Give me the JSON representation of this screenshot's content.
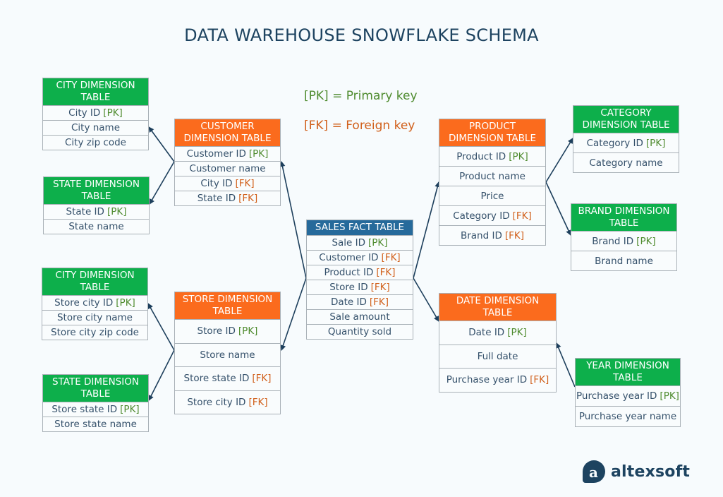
{
  "title": "DATA WAREHOUSE SNOWFLAKE SCHEMA",
  "legend": {
    "pk": "[PK] = Primary key",
    "fk": "[FK] = Foreign key"
  },
  "colors": {
    "dimension_header": "#0daf4b",
    "first_level_header": "#fb6b1d",
    "fact_header": "#266a9b",
    "pk_text": "#4e8b2e",
    "fk_text": "#d1601b",
    "connector": "#1d3f5c"
  },
  "tables": {
    "city_customer": {
      "title": "CITY DIMENSION TABLE",
      "rows": [
        {
          "text": "City ID",
          "key": "[PK]"
        },
        {
          "text": "City name",
          "key": ""
        },
        {
          "text": "City zip code",
          "key": ""
        }
      ]
    },
    "state_customer": {
      "title": "STATE DIMENSION TABLE",
      "rows": [
        {
          "text": "State ID",
          "key": "[PK]"
        },
        {
          "text": "State name",
          "key": ""
        }
      ]
    },
    "customer": {
      "title": "CUSTOMER DIMENSION TABLE",
      "rows": [
        {
          "text": "Customer ID",
          "key": "[PK]"
        },
        {
          "text": "Customer name",
          "key": ""
        },
        {
          "text": "City ID",
          "key": "[FK]"
        },
        {
          "text": "State ID",
          "key": "[FK]"
        }
      ]
    },
    "city_store": {
      "title": "CITY DIMENSION TABLE",
      "rows": [
        {
          "text": "Store city ID",
          "key": "[PK]"
        },
        {
          "text": "Store city name",
          "key": ""
        },
        {
          "text": "Store city zip code",
          "key": ""
        }
      ]
    },
    "state_store": {
      "title": "STATE DIMENSION TABLE",
      "rows": [
        {
          "text": "Store state ID",
          "key": "[PK]"
        },
        {
          "text": "Store state name",
          "key": ""
        }
      ]
    },
    "store": {
      "title": "STORE DIMENSION TABLE",
      "rows": [
        {
          "text": "Store ID",
          "key": "[PK]"
        },
        {
          "text": "Store name",
          "key": ""
        },
        {
          "text": "Store state ID",
          "key": "[FK]"
        },
        {
          "text": "Store city ID",
          "key": "[FK]"
        }
      ]
    },
    "sales": {
      "title": "SALES FACT TABLE",
      "rows": [
        {
          "text": "Sale ID",
          "key": "[PK]"
        },
        {
          "text": "Customer ID",
          "key": "[FK]"
        },
        {
          "text": "Product ID",
          "key": "[FK]"
        },
        {
          "text": "Store ID",
          "key": "[FK]"
        },
        {
          "text": "Date ID",
          "key": "[FK]"
        },
        {
          "text": "Sale amount",
          "key": ""
        },
        {
          "text": "Quantity sold",
          "key": ""
        }
      ]
    },
    "product": {
      "title": "PRODUCT DIMENSION TABLE",
      "rows": [
        {
          "text": "Product ID",
          "key": "[PK]"
        },
        {
          "text": "Product name",
          "key": ""
        },
        {
          "text": "Price",
          "key": ""
        },
        {
          "text": "Category ID",
          "key": "[FK]"
        },
        {
          "text": "Brand ID",
          "key": "[FK]"
        }
      ]
    },
    "category": {
      "title": "CATEGORY DIMENSION TABLE",
      "rows": [
        {
          "text": "Category ID",
          "key": "[PK]"
        },
        {
          "text": "Category name",
          "key": ""
        }
      ]
    },
    "brand": {
      "title": "BRAND DIMENSION TABLE",
      "rows": [
        {
          "text": "Brand ID",
          "key": "[PK]"
        },
        {
          "text": "Brand name",
          "key": ""
        }
      ]
    },
    "date": {
      "title": "DATE DIMENSION TABLE",
      "rows": [
        {
          "text": "Date ID",
          "key": "[PK]"
        },
        {
          "text": "Full date",
          "key": ""
        },
        {
          "text": "Purchase year ID",
          "key": "[FK]"
        }
      ]
    },
    "year": {
      "title": "YEAR DIMENSION TABLE",
      "rows": [
        {
          "text": "Purchase year ID",
          "key": "[PK]"
        },
        {
          "text": "Purchase year name",
          "key": ""
        }
      ]
    }
  },
  "relationships": [
    {
      "from": "sales",
      "to": "customer"
    },
    {
      "from": "sales",
      "to": "store"
    },
    {
      "from": "sales",
      "to": "product"
    },
    {
      "from": "sales",
      "to": "date"
    },
    {
      "from": "customer",
      "to": "city_customer"
    },
    {
      "from": "customer",
      "to": "state_customer"
    },
    {
      "from": "store",
      "to": "city_store"
    },
    {
      "from": "store",
      "to": "state_store"
    },
    {
      "from": "product",
      "to": "category"
    },
    {
      "from": "product",
      "to": "brand"
    },
    {
      "from": "year",
      "to": "date"
    }
  ],
  "logo": {
    "mark": "a",
    "text": "altexsoft"
  }
}
